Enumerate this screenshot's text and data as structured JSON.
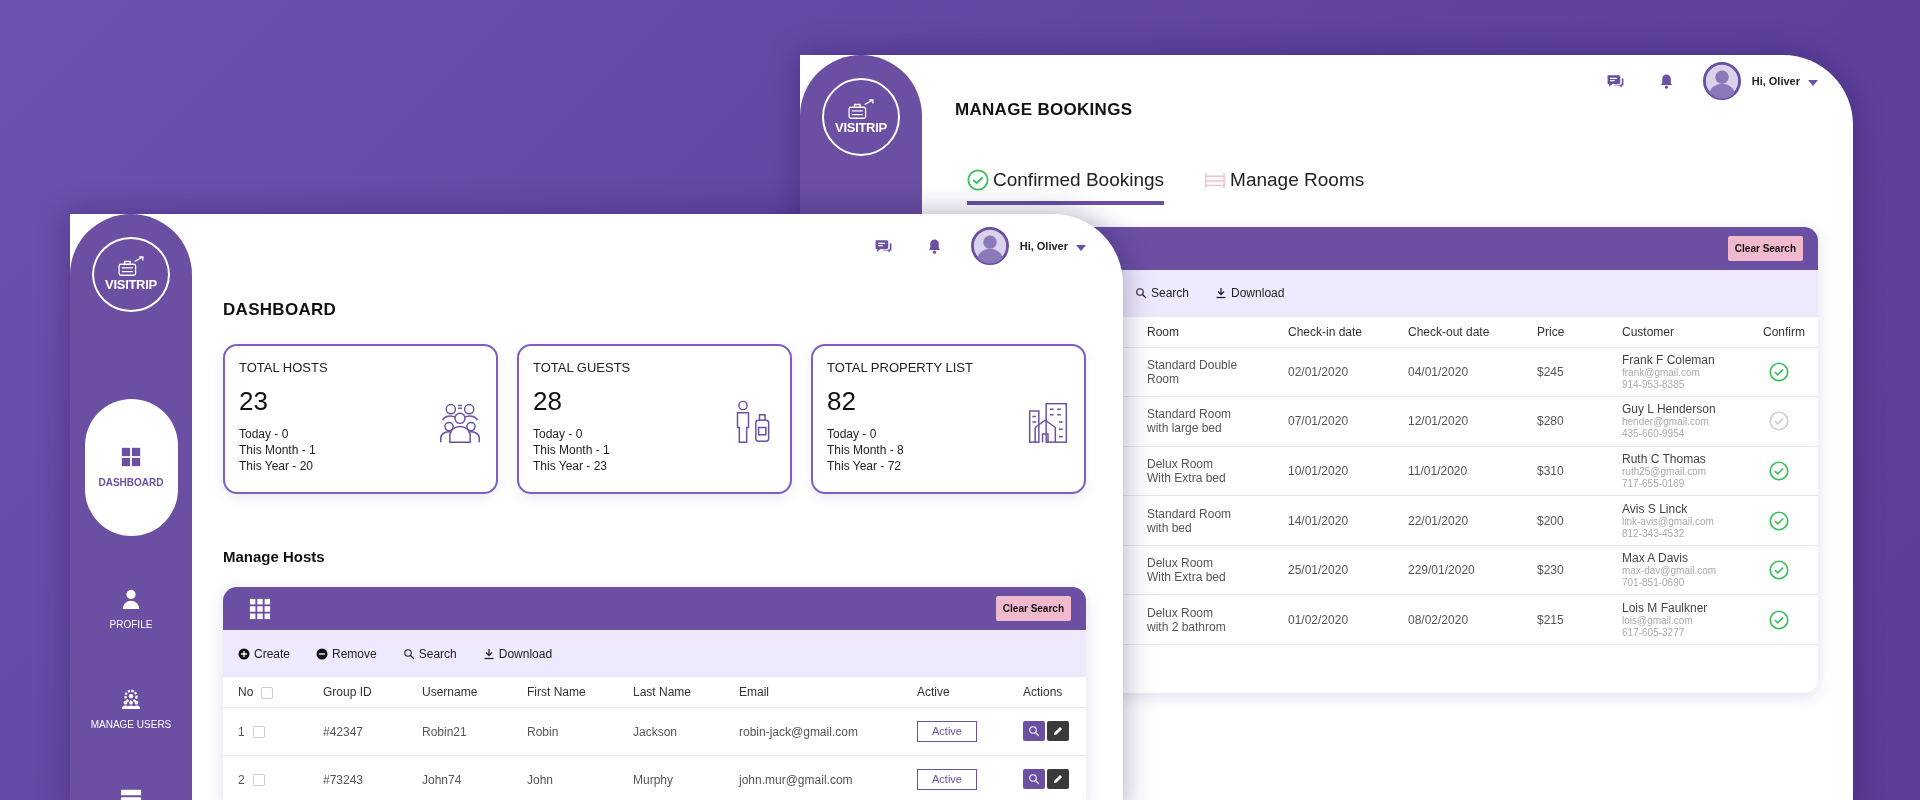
{
  "back_window": {
    "logo": "VISITRIP",
    "user_name": "Hi, Oliver",
    "title": "MANAGE BOOKINGS",
    "tabs": [
      {
        "label": "Confirmed Bookings",
        "kind": "check",
        "selected": true
      },
      {
        "label": "Manage Rooms",
        "kind": "bed",
        "selected": false
      }
    ],
    "bookings_table": {
      "clear_button": "Clear Search",
      "toolbar": [
        {
          "label": "Search",
          "kind": "search"
        },
        {
          "label": "Download",
          "kind": "download"
        }
      ],
      "columns": [
        "Room",
        "Check-in date",
        "Check-out date",
        "Price",
        "Customer",
        "Confirm"
      ],
      "rows": [
        {
          "room": "Standard Double\nRoom",
          "check_in": "02/01/2020",
          "check_out": "04/01/2020",
          "price": "$245",
          "customer_name": "Frank F Coleman",
          "customer_email": "frank@gmail.com",
          "customer_phone": "914-953-8385",
          "confirmed": true
        },
        {
          "room": "Standard Room\nwith large bed",
          "check_in": "07/01/2020",
          "check_out": "12/01/2020",
          "price": "$280",
          "customer_name": "Guy L Henderson",
          "customer_email": "hender@gmail.com",
          "customer_phone": "435-660-9954",
          "confirmed": false
        },
        {
          "room": "Delux Room\nWith Extra bed",
          "check_in": "10/01/2020",
          "check_out": "11/01/2020",
          "price": "$310",
          "customer_name": "Ruth C Thomas",
          "customer_email": "ruth25@gmail.com",
          "customer_phone": "717-655-0169",
          "confirmed": true
        },
        {
          "room": "Standard Room\nwith bed",
          "check_in": "14/01/2020",
          "check_out": "22/01/2020",
          "price": "$200",
          "customer_name": "Avis S Linck",
          "customer_email": "link-avis@gmail.com",
          "customer_phone": "812-343-4532",
          "confirmed": true
        },
        {
          "room": "Delux Room\nWith Extra bed",
          "check_in": "25/01/2020",
          "check_out": "229/01/2020",
          "price": "$230",
          "customer_name": "Max A Davis",
          "customer_email": "max-dav@gmail.com",
          "customer_phone": "701-851-0690",
          "confirmed": true
        },
        {
          "room": "Delux Room\nwith 2 bathrom",
          "check_in": "01/02/2020",
          "check_out": "08/02/2020",
          "price": "$215",
          "customer_name": "Lois M Faulkner",
          "customer_email": "lois@gmail.com",
          "customer_phone": "617-605-3277",
          "confirmed": true
        }
      ]
    }
  },
  "front_window": {
    "logo": "VISITRIP",
    "sidebar_items": [
      {
        "label": "DASHBOARD",
        "kind": "grid",
        "selected": true
      },
      {
        "label": "PROFILE",
        "kind": "person",
        "selected": false
      },
      {
        "label": "MANAGE USERS",
        "kind": "users",
        "selected": false
      },
      {
        "kind": "server",
        "selected": false
      }
    ],
    "user_name": "Hi, Oliver",
    "title": "DASHBOARD",
    "stats": [
      {
        "title": "TOTAL HOSTS",
        "value": "23",
        "lines": [
          "Today - 0",
          "This Month - 1",
          "This Year - 20"
        ],
        "kind": "group"
      },
      {
        "title": "TOTAL GUESTS",
        "value": "28",
        "lines": [
          "Today - 0",
          "This Month - 1",
          "This Year - 23"
        ],
        "kind": "traveler"
      },
      {
        "title": "TOTAL PROPERTY LIST",
        "value": "82",
        "lines": [
          "Today - 0",
          "This Month - 8",
          "This Year - 72"
        ],
        "kind": "buildings"
      }
    ],
    "section_title": "Manage Hosts",
    "hosts_table": {
      "clear_button": "Clear Search",
      "toolbar": [
        {
          "label": "Create",
          "kind": "create"
        },
        {
          "label": "Remove",
          "kind": "remove"
        },
        {
          "label": "Search",
          "kind": "search"
        },
        {
          "label": "Download",
          "kind": "download"
        }
      ],
      "columns": [
        "No",
        "Group ID",
        "Username",
        "First Name",
        "Last Name",
        "Email",
        "Active",
        "Actions"
      ],
      "select_all_checked": false,
      "rows": [
        {
          "no": "1",
          "checked": false,
          "group_id": "#42347",
          "username": "Robin21",
          "first_name": "Robin",
          "last_name": "Jackson",
          "email": "robin-jack@gmail.com",
          "status": "Active"
        },
        {
          "no": "2",
          "checked": false,
          "group_id": "#73243",
          "username": "John74",
          "first_name": "John",
          "last_name": "Murphy",
          "email": "john.mur@gmail.com",
          "status": "Active"
        }
      ]
    }
  }
}
